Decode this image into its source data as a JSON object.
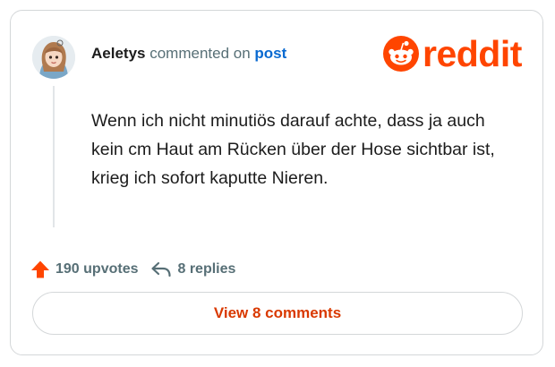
{
  "comment": {
    "username": "Aeletys",
    "action_text": "commented on",
    "post_link": "post",
    "body": "Wenn ich nicht minutiös darauf achte, dass ja auch kein cm Haut am Rücken über der Hose sichtbar ist, krieg ich sofort kaputte Nieren."
  },
  "brand": {
    "wordmark": "reddit",
    "color": "#ff4500"
  },
  "stats": {
    "upvotes": "190 upvotes",
    "replies": "8 replies"
  },
  "footer": {
    "view_comments_label": "View 8 comments"
  },
  "icons": {
    "upvote": "arrow-up-icon",
    "reply": "reply-arrow-icon",
    "logo": "reddit-snoo-icon"
  },
  "colors": {
    "accent": "#ff4500",
    "link": "#0a6ad1",
    "muted": "#576f76",
    "button_text": "#d93900"
  }
}
